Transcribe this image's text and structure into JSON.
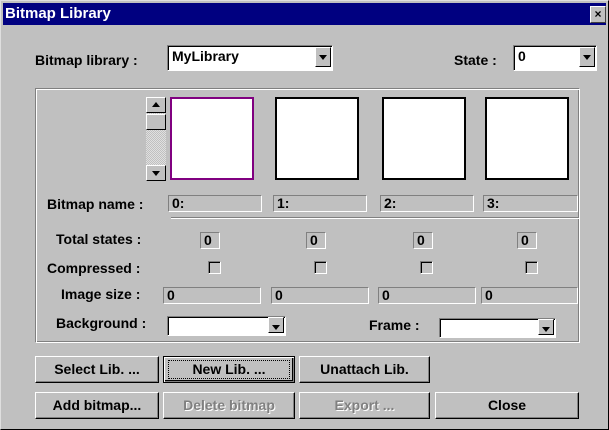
{
  "window": {
    "title": "Bitmap Library",
    "close_glyph": "×"
  },
  "library": {
    "label": "Bitmap library :",
    "value": "MyLibrary"
  },
  "state": {
    "label": "State :",
    "value": "0"
  },
  "slots": {
    "bitmap_name_label": "Bitmap name :",
    "total_states_label": "Total states :",
    "compressed_label": "Compressed :",
    "image_size_label": "Image size :",
    "names": [
      "0:",
      "1:",
      "2:",
      "3:"
    ],
    "total_states": [
      "0",
      "0",
      "0",
      "0"
    ],
    "compressed": [
      false,
      false,
      false,
      false
    ],
    "image_sizes": [
      "0",
      "0",
      "0",
      "0"
    ]
  },
  "background": {
    "label": "Background :",
    "value": "",
    "color": "#ffffff"
  },
  "frame": {
    "label": "Frame :",
    "value": "",
    "color": "#ffffff"
  },
  "buttons": {
    "select_lib": "Select Lib. ...",
    "new_lib": "New Lib. ...",
    "unattach_lib": "Unattach Lib.",
    "add_bitmap": "Add bitmap...",
    "delete_bitmap": "Delete bitmap",
    "export": "Export ...",
    "close": "Close"
  },
  "colors": {
    "title_bar": "#000080",
    "face": "#c0c0c0",
    "selected_frame": "#800080"
  }
}
